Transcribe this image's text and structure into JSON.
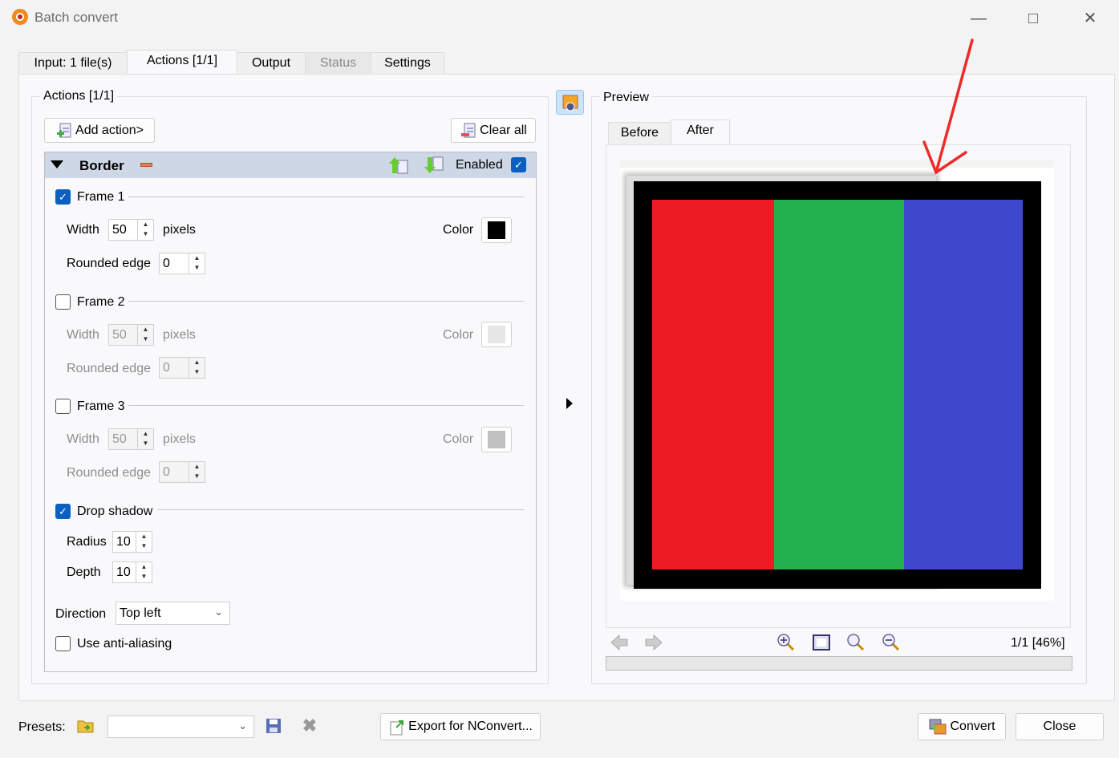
{
  "window": {
    "title": "Batch convert"
  },
  "tabs": [
    {
      "label": "Input: 1 file(s)"
    },
    {
      "label": "Actions [1/1]"
    },
    {
      "label": "Output"
    },
    {
      "label": "Status"
    },
    {
      "label": "Settings"
    }
  ],
  "actions": {
    "group_title": "Actions [1/1]",
    "add_action": "Add action>",
    "clear_all": "Clear all",
    "header": {
      "name": "Border",
      "enabled_label": "Enabled",
      "enabled": true
    },
    "frames": [
      {
        "label": "Frame 1",
        "checked": true,
        "width_label": "Width",
        "width": "50",
        "pixels": "pixels",
        "color_label": "Color",
        "color": "#000000",
        "rounded_label": "Rounded edge",
        "rounded": "0"
      },
      {
        "label": "Frame 2",
        "checked": false,
        "width_label": "Width",
        "width": "50",
        "pixels": "pixels",
        "color_label": "Color",
        "color": "#e6e6e6",
        "rounded_label": "Rounded edge",
        "rounded": "0"
      },
      {
        "label": "Frame 3",
        "checked": false,
        "width_label": "Width",
        "width": "50",
        "pixels": "pixels",
        "color_label": "Color",
        "color": "#c0c0c0",
        "rounded_label": "Rounded edge",
        "rounded": "0"
      }
    ],
    "shadow": {
      "label": "Drop shadow",
      "checked": true,
      "radius_label": "Radius",
      "radius": "10",
      "depth_label": "Depth",
      "depth": "10"
    },
    "direction": {
      "label": "Direction",
      "value": "Top left"
    },
    "antialias": {
      "label": "Use anti-aliasing",
      "checked": false
    }
  },
  "preview": {
    "title": "Preview",
    "tabs": [
      "Before",
      "After"
    ],
    "page_info": "1/1 [46%]",
    "stripe_colors": [
      "#ed1c24",
      "#22b14c",
      "#3f48cc"
    ]
  },
  "footer": {
    "presets_label": "Presets:",
    "presets_value": "",
    "export": "Export for NConvert...",
    "convert": "Convert",
    "close": "Close"
  }
}
